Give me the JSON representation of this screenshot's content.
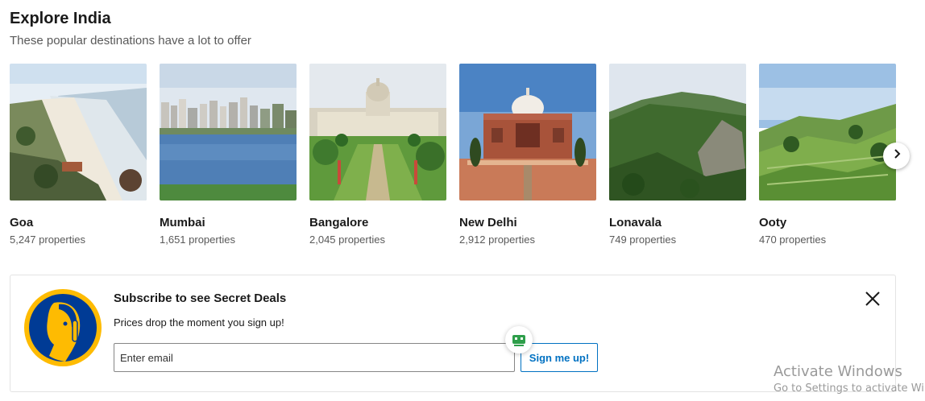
{
  "section": {
    "title": "Explore India",
    "subtitle": "These popular destinations have a lot to offer"
  },
  "destinations": [
    {
      "name": "Goa",
      "count": "5,247 properties",
      "image": "beach"
    },
    {
      "name": "Mumbai",
      "count": "1,651 properties",
      "image": "skyline-lake"
    },
    {
      "name": "Bangalore",
      "count": "2,045 properties",
      "image": "government-building"
    },
    {
      "name": "New Delhi",
      "count": "2,912 properties",
      "image": "tomb-monument"
    },
    {
      "name": "Lonavala",
      "count": "749 properties",
      "image": "green-mountains"
    },
    {
      "name": "Ooty",
      "count": "470 properties",
      "image": "hill-plantations"
    }
  ],
  "carousel": {
    "next_icon": "chevron-right-icon"
  },
  "subscribe": {
    "title": "Subscribe to see Secret Deals",
    "text": "Prices drop the moment you sign up!",
    "email_placeholder": "Enter email",
    "button_label": "Sign me up!",
    "close_icon": "close-icon",
    "logo_icon": "secret-deals-logo",
    "logo_colors": {
      "ring": "#febb02",
      "bg": "#003b95"
    }
  },
  "watermark": {
    "title": "Activate Windows",
    "subtitle": "Go to Settings to activate Wi"
  }
}
